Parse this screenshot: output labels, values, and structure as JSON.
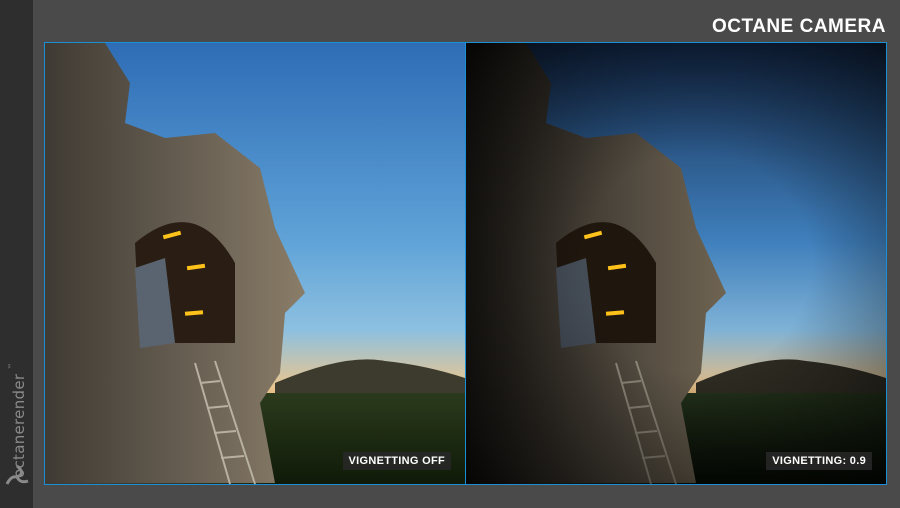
{
  "header": {
    "title": "OCTANE CAMERA"
  },
  "brand": {
    "name": "octanerender",
    "trademark": "™",
    "icon": "octane-logo-icon"
  },
  "panels": [
    {
      "caption": "VIGNETTING OFF"
    },
    {
      "caption": "VIGNETTING: 0.9"
    }
  ],
  "colors": {
    "frame_border": "#1a8fd6",
    "sky_top": "#2f6fb8",
    "sky_bottom": "#f0c48a",
    "lights": "#ffc21a"
  }
}
